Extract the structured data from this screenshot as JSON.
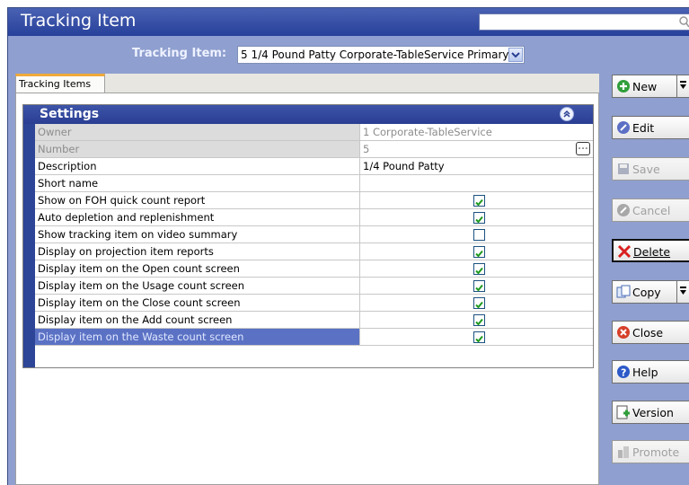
{
  "window": {
    "title": "Tracking Item"
  },
  "selector": {
    "label": "Tracking Item:",
    "value": "5 1/4 Pound Patty Corporate-TableService Primary"
  },
  "tabs": [
    {
      "label": "Tracking Items"
    }
  ],
  "settings": {
    "title": "Settings",
    "rows": [
      {
        "name": "Owner",
        "value": "1  Corporate-TableService"
      },
      {
        "name": "Number",
        "value": "5"
      },
      {
        "name": "Description",
        "value": "1/4 Pound Patty"
      },
      {
        "name": "Short name",
        "value": ""
      },
      {
        "name": "Show on FOH quick count report",
        "checked": true
      },
      {
        "name": "Auto depletion and replenishment",
        "checked": true
      },
      {
        "name": "Show tracking item on video summary",
        "checked": false
      },
      {
        "name": "Display on projection item reports",
        "checked": true
      },
      {
        "name": "Display item on the Open count screen",
        "checked": true
      },
      {
        "name": "Display item on the Usage count screen",
        "checked": true
      },
      {
        "name": "Display item on the Close count screen",
        "checked": true
      },
      {
        "name": "Display item on the Add count screen",
        "checked": true
      },
      {
        "name": "Display item on the Waste count screen",
        "checked": true
      }
    ]
  },
  "actions": {
    "new": "New",
    "edit": "Edit",
    "save": "Save",
    "cancel": "Cancel",
    "delete": "Delete",
    "copy": "Copy",
    "close": "Close",
    "help": "Help",
    "version": "Version",
    "promote": "Promote"
  },
  "colors": {
    "accent": "#2a3f92",
    "tab_highlight": "#f0a93a",
    "selected_row": "#5b72c4"
  }
}
